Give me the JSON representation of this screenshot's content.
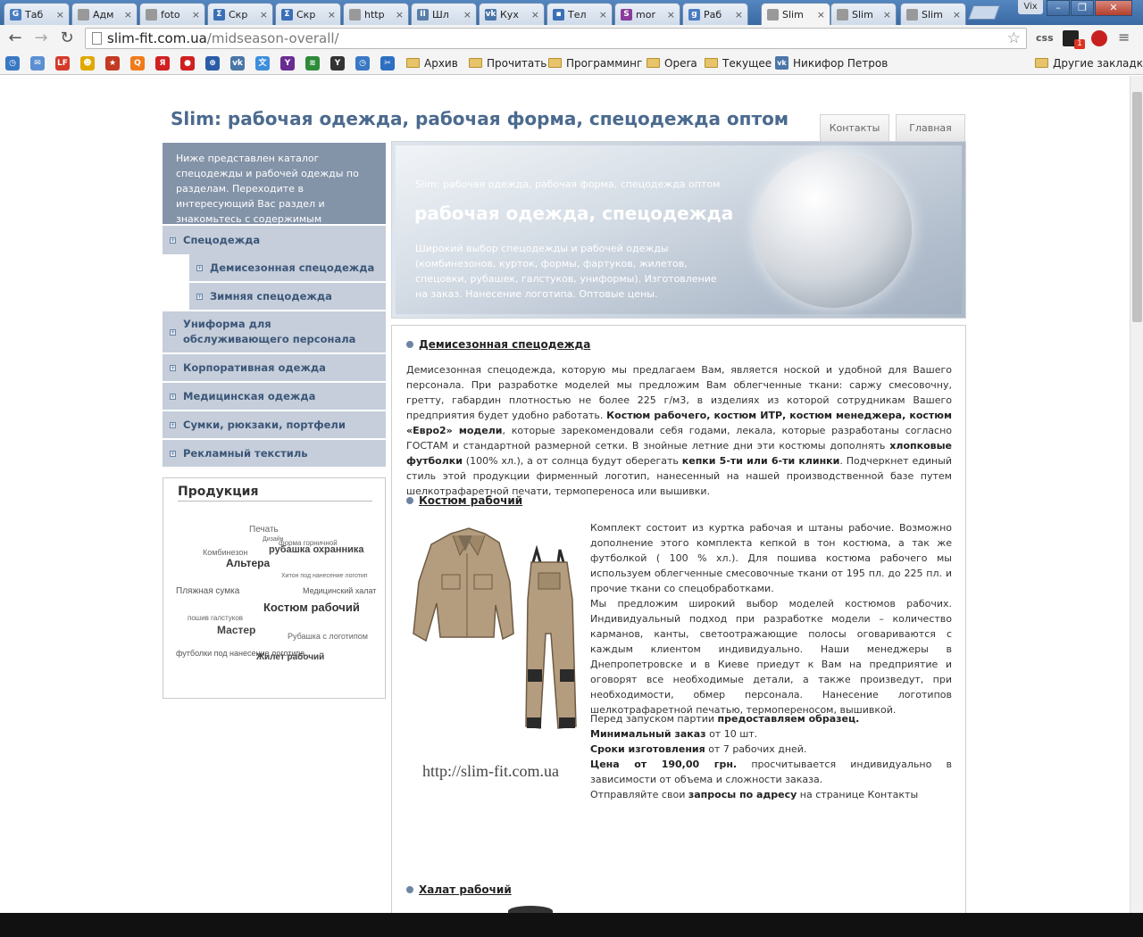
{
  "browser": {
    "tabs": [
      {
        "label": "Таб",
        "favicon_color": "#4a7cc2",
        "favicon": "G"
      },
      {
        "label": "Адм",
        "favicon_color": "#999999",
        "favicon": ""
      },
      {
        "label": "foto",
        "favicon_color": "#999999",
        "favicon": ""
      },
      {
        "label": "Скр",
        "favicon_color": "#3b6fb6",
        "favicon": "Σ"
      },
      {
        "label": "Скр",
        "favicon_color": "#3b6fb6",
        "favicon": "Σ"
      },
      {
        "label": "http",
        "favicon_color": "#999999",
        "favicon": ""
      },
      {
        "label": "Шл",
        "favicon_color": "#5a7fa8",
        "favicon": "II"
      },
      {
        "label": "Кух",
        "favicon_color": "#4a76a8",
        "favicon": "vk"
      },
      {
        "label": "Тел",
        "favicon_color": "#3b6fb6",
        "favicon": "▪"
      },
      {
        "label": "mor",
        "favicon_color": "#8a3b9b",
        "favicon": "S"
      },
      {
        "label": "Раб",
        "favicon_color": "#4a7cc2",
        "favicon": "g"
      },
      {
        "label": "Slim",
        "favicon_color": "#999999",
        "favicon": "",
        "active": true
      },
      {
        "label": "Slim",
        "favicon_color": "#999999",
        "favicon": ""
      },
      {
        "label": "Slim",
        "favicon_color": "#999999",
        "favicon": ""
      }
    ],
    "window_user": "Vix",
    "window_buttons": {
      "minimize": "–",
      "maximize": "❐",
      "close": "✕"
    },
    "url_host": "slim-fit.com.ua",
    "url_path": "/midseason-overall/",
    "ext_css": "css",
    "ext_badge": "1",
    "bookmark_icons": [
      {
        "label": "◷",
        "color": "#3a78c4"
      },
      {
        "label": "✉",
        "color": "#5b8fd1"
      },
      {
        "label": "LF",
        "color": "#d43a2a"
      },
      {
        "label": "☻",
        "color": "#e0a800"
      },
      {
        "label": "★",
        "color": "#c23b22"
      },
      {
        "label": "Q",
        "color": "#f07b1a"
      },
      {
        "label": "Я",
        "color": "#d02020"
      },
      {
        "label": "●",
        "color": "#d02020"
      },
      {
        "label": "⊕",
        "color": "#2a5ca8"
      },
      {
        "label": "vk",
        "color": "#4a76a8"
      },
      {
        "label": "文",
        "color": "#3d8fdb"
      },
      {
        "label": "Y",
        "color": "#6a2c91"
      },
      {
        "label": "≋",
        "color": "#2e8b3a"
      },
      {
        "label": "Y",
        "color": "#333333"
      },
      {
        "label": "◷",
        "color": "#3a78c4"
      },
      {
        "label": "✂",
        "color": "#2d6fc1"
      }
    ],
    "bookmark_folders": [
      "Архив",
      "Прочитать",
      "Программинг",
      "Opera",
      "Текущее"
    ],
    "bookmark_vk_label": "Никифор Петров",
    "other_bookmarks": "Другие закладки"
  },
  "site": {
    "title": "Slim: рабочая одежда, рабочая форма, спецодежда оптом",
    "top_tabs": [
      "Контакты",
      "Главная"
    ],
    "intro": "Ниже представлен каталог спецодежды и рабочей одежды по разделам. Переходите в интересующий Вас раздел и знакомьтесь с содержимым подробнее.",
    "menu": [
      "Спецодежда",
      "Демисезонная спецодежда",
      "Зимняя спецодежда",
      "Униформа для обслуживающего персонала",
      "Корпоративная одежда",
      "Медицинская одежда",
      "Сумки, рюкзаки, портфели",
      "Рекламный текстиль"
    ],
    "products_title": "Продукция",
    "tag_cloud": [
      "Печать",
      "Дизайн",
      "форма горничной",
      "Комбинезон",
      "рубашка охранника",
      "Альтера",
      "Хитон под нанесение логотип",
      "Пляжная сумка",
      "Медицинский халат",
      "Костюм рабочий",
      "пошив галстуков",
      "Мастер",
      "Рубашка с логотипом",
      "футболки под нанесение логотипа",
      "Жилет рабочий"
    ],
    "banner": {
      "small": "Slim: рабочая одежда, рабочая форма, спецодежда оптом",
      "heading": "рабочая одежда, спецодежда",
      "desc": "Широкий выбор спецодежды и рабочей одежды (комбинезонов, курток, формы, фартуков, жилетов, спецовки, рубашек, галстуков, униформы). Изготовление на заказ. Нанесение логотипа. Оптовые цены."
    },
    "sections": {
      "s1_title": "Демисезонная спецодежда",
      "s1_text_a": "Демисезонная спецодежда, которую мы предлагаем Вам, является ноской и удобной для Вашего персонала. При разработке моделей мы предложим Вам облегченные ткани: саржу смесовочну, гретту, габардин плотностью не более 225 г/м3, в изделиях из которой сотрудникам Вашего предприятия будет удобно работать. ",
      "s1_bold_a": "Костюм рабочего, костюм ИТР, костюм менеджера, костюм «Евро2» модели",
      "s1_text_b": ", которые зарекомендовали себя годами, лекала, которые разработаны согласно ГОСТАМ и стандартной размерной сетки. В знойные летние дни эти костюмы дополнять ",
      "s1_bold_b": "хлопковые футболки",
      "s1_text_c": " (100% хл.), а от солнца будут оберегать ",
      "s1_bold_c": "кепки 5-ти или 6-ти клинки",
      "s1_text_d": ". Подчеркнет единый стиль этой продукции фирменный логотип, нанесенный на нашей производственной базе путем шелкотрафаретной печати, термопереноса или вышивки.",
      "s2_title": "Костюм рабочий",
      "s2_text": "Комплект состоит из куртка рабочая и штаны рабочие. Возможно дополнение этого комплекта кепкой в тон костюма, а так же футболкой ( 100 % хл.). Для пошива костюма рабочего мы используем облегченные смесовочные ткани от 195 пл. до 225 пл. и прочие ткани со спецобработками.",
      "s2_text2": "Мы предложим широкий выбор моделей костюмов рабочих. Индивидуальный подход при разработке модели – количество карманов, канты, светоотражающие полосы оговариваются с каждым клиентом индивидуально. Наши менеджеры в Днепропетровске и в Киеве приедут к Вам на предприятие и оговорят все необходимые детали, а также произведут, при необходимости, обмер персонала. Нанесение логотипов шелкотрафаретной печатью, термопереносом, вышивкой.",
      "s2_sample_a": "Перед запуском партии ",
      "s2_sample_b": "предоставляем образец.",
      "s2_min_b": "Минимальный заказ",
      "s2_min_t": " от 10 шт.",
      "s2_term_b": "Сроки изготовления",
      "s2_term_t": " от 7 рабочих дней.",
      "s2_price_b": "Цена от 190,00 грн.",
      "s2_price_t": " просчитывается индивидуально в зависимости от объема и сложности заказа.",
      "s2_req_a": "Отправляйте свои ",
      "s2_req_b": "запросы по адресу",
      "s2_req_c": " на странице Контакты",
      "image_caption": "http://slim-fit.com.ua",
      "s3_title": "Халат рабочий"
    }
  }
}
